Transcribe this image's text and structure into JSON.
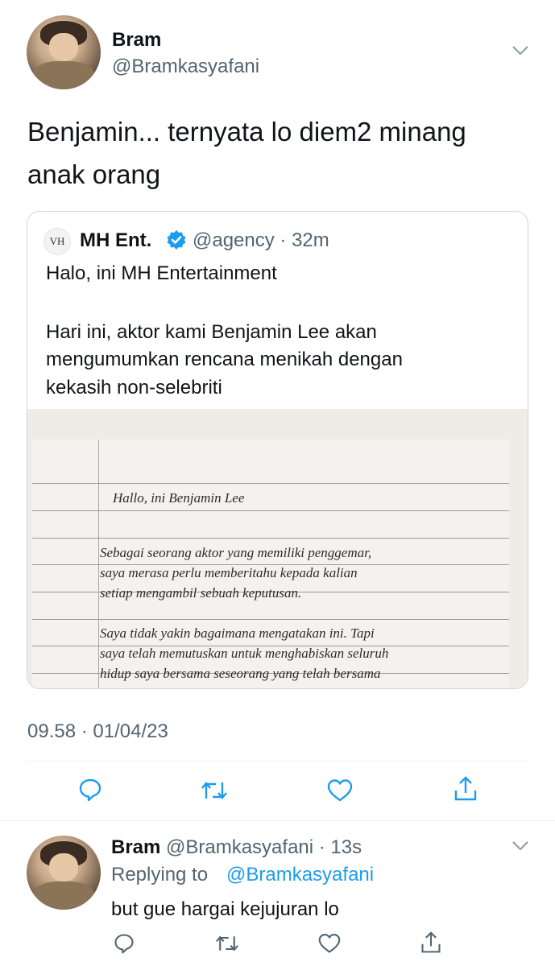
{
  "main_tweet": {
    "author_name": "Bram",
    "author_handle": "@Bramkasyafani",
    "text_line1": "Benjamin... ternyata lo diem2 minang",
    "text_line2": "anak orang",
    "timestamp": "09.58 · 01/04/23",
    "more_icon": "chevron-down-icon"
  },
  "quoted_tweet": {
    "logo_text": "VH",
    "author_name": "MH Ent.",
    "verified_icon": "verified-badge-icon",
    "handle_time": "@agency · 32m",
    "line1": "Halo, ini MH Entertainment",
    "line2": "Hari ini, aktor kami Benjamin Lee akan",
    "line3": "mengumumkan rencana menikah dengan",
    "line4": "kekasih non-selebriti",
    "note": {
      "greeting": "Hallo, ini Benjamin Lee",
      "p1_l1": "Sebagai seorang aktor yang memiliki penggemar,",
      "p1_l2": "saya merasa perlu memberitahu kepada kalian",
      "p1_l3": "setiap mengambil sebuah keputusan.",
      "p2_l1": "Saya tidak yakin bagaimana mengatakan ini. Tapi",
      "p2_l2": "saya telah memutuskan untuk menghabiskan seluruh",
      "p2_l3": "hidup saya bersama seseorang yang telah bersama"
    }
  },
  "actions": [
    "reply-icon",
    "retweet-icon",
    "like-icon",
    "share-icon"
  ],
  "reply_tweet": {
    "author_name": "Bram",
    "handle_time": "@Bramkasyafani · 13s",
    "replying_label": "Replying to",
    "replying_handle": "@Bramkasyafani",
    "text": "but gue hargai kejujuran lo"
  },
  "colors": {
    "link": "#1d9bf0",
    "muted": "#536471",
    "verified": "#1d9bf0"
  }
}
